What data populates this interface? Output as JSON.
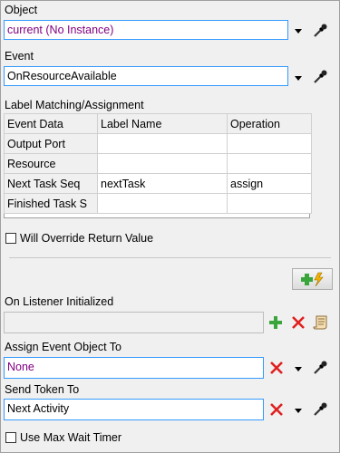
{
  "object": {
    "label": "Object",
    "value": "current (No Instance)"
  },
  "event": {
    "label": "Event",
    "value": "OnResourceAvailable"
  },
  "label_matching": {
    "label": "Label Matching/Assignment",
    "headers": [
      "Event Data",
      "Label Name",
      "Operation"
    ],
    "rows": [
      [
        "Output Port",
        "",
        ""
      ],
      [
        "Resource",
        "",
        ""
      ],
      [
        "Next Task Seq",
        "nextTask",
        "assign"
      ],
      [
        "Finished  Task S",
        "",
        ""
      ]
    ]
  },
  "override_checkbox": {
    "label": "Will Override Return Value",
    "checked": false
  },
  "on_listener": {
    "label": "On Listener Initialized",
    "value": ""
  },
  "assign_event_object": {
    "label": "Assign Event Object To",
    "value": "None"
  },
  "send_token": {
    "label": "Send Token To",
    "value": "Next Activity"
  },
  "max_wait": {
    "label": "Use Max Wait Timer",
    "checked": false
  },
  "colors": {
    "accent": "#3399ff",
    "purple_text": "#800080",
    "red_x": "#e02020",
    "green_plus": "#3aa53a"
  },
  "icons": [
    "chevron-down-icon",
    "eyedropper-icon",
    "add-icon",
    "delete-icon",
    "script-icon"
  ]
}
